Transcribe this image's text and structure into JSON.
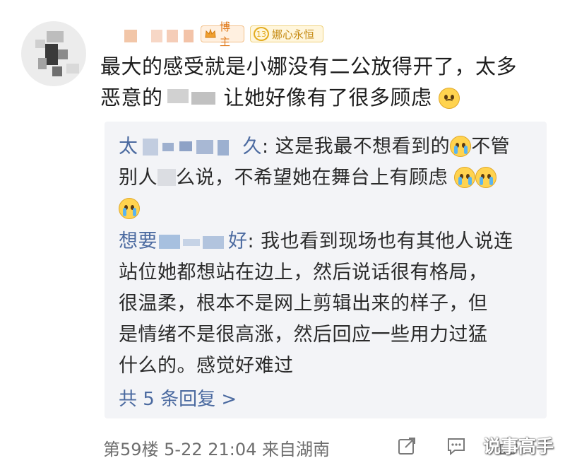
{
  "badges": {
    "blogger": "博主",
    "fan_level": "13",
    "fan_name": "娜心永恒"
  },
  "comment": {
    "line1": "最大的感受就是小娜没有二公放得开了，太多",
    "line2_a": "恶意的",
    "line2_b": "让她好像有了很多顾虑"
  },
  "replies": [
    {
      "user_a": "太",
      "user_b": "久",
      "text_line1": ": 这是我最不想看到的",
      "text_line1b": "不管",
      "text_line2a": "别人",
      "text_line2b": "么说，不希望她在舞台上有顾虑"
    },
    {
      "user_a": "想要",
      "user_b": "好",
      "lines": [
        ": 我也看到现场也有其他人说连",
        "站位她都想站在边上，然后说话很有格局，",
        "很温柔，根本不是网上剪辑出来的样子，但",
        "是情绪不是很高涨，然后回应一些用力过猛",
        "什么的。感觉好难过"
      ]
    }
  ],
  "more_replies": "共 5 条回复 >",
  "footer": {
    "meta": "第59楼 5-22 21:04 来自湖南"
  },
  "icons": [
    "crown-icon",
    "comment-icon",
    "share-icon",
    "like-icon"
  ],
  "watermark": "说事高手"
}
